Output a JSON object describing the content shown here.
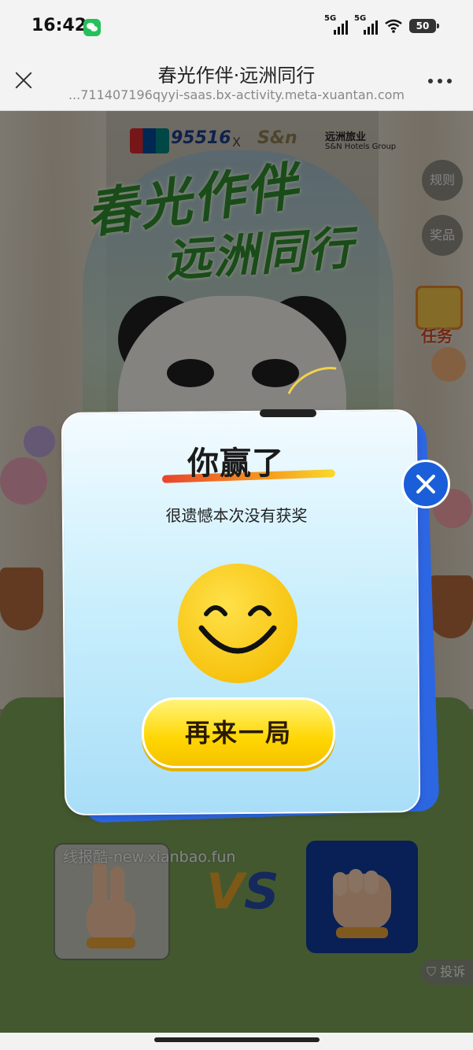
{
  "status_bar": {
    "time": "16:42",
    "signal1_label": "5G",
    "signal2_label": "5G",
    "battery": "50",
    "icons": [
      "wechat-icon",
      "signal-icon",
      "signal-icon",
      "wifi-icon",
      "battery-icon"
    ]
  },
  "nav": {
    "title": "春光作伴·远洲同行",
    "url": "...711407196qyyi-saas.bx-activity.meta-xuantan.com",
    "icons": [
      "close-icon",
      "more-icon"
    ]
  },
  "background": {
    "brand_number": "95516",
    "brand_x": "X",
    "brand_sn": "S&n",
    "brand_name": "远洲旅业",
    "brand_name_en": "S&N Hotels Group",
    "title_line1": "春光作伴",
    "title_line2": "远洲同行",
    "rules_label": "规则",
    "prizes_label": "奖品",
    "task_label": "任务",
    "vs_v": "V",
    "vs_s": "S",
    "watermark": "线报酷-new.xianbao.fun",
    "report_label": "投诉"
  },
  "modal": {
    "title": "你赢了",
    "message": "很遗憾本次没有获奖",
    "button": "再来一局",
    "icons": [
      "smiley-icon",
      "close-icon"
    ]
  },
  "colors": {
    "modal_accent": "#2d66e2",
    "button_yellow": "#ffd600",
    "title_green": "#2f8a2f"
  }
}
